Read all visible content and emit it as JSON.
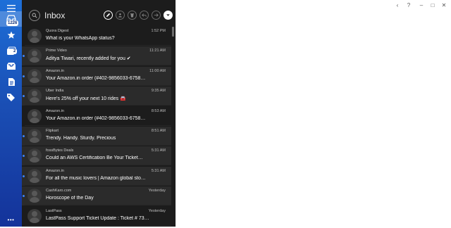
{
  "window": {
    "controls": {
      "back": "‹",
      "help": "?",
      "minimize": "–",
      "maximize": "□",
      "close": "✕"
    }
  },
  "rail": {
    "badge": "1226",
    "badge2": "2",
    "more": "•••"
  },
  "header": {
    "title": "Inbox"
  },
  "messages": [
    {
      "sender": "Quora Digest",
      "time": "1:52 PM",
      "subject": "What is your WhatsApp status?",
      "unread": false
    },
    {
      "sender": "Prime Video",
      "time": "11:21 AM",
      "subject": "Aditya Tiwari, recently added for you ✔",
      "unread": true
    },
    {
      "sender": "Amazon.in",
      "time": "11:00 AM",
      "subject": "Your Amazon.in order (#402-9856033-6758…",
      "unread": true
    },
    {
      "sender": "Uber India",
      "time": "9:35 AM",
      "subject": "Here's 25% off your next 10 rides 🚘",
      "unread": true
    },
    {
      "sender": "Amazon.in",
      "time": "8:53 AM",
      "subject": "Your Amazon.in order (#402-9856033-6758…",
      "unread": false
    },
    {
      "sender": "Flipkart",
      "time": "8:51 AM",
      "subject": "Trendy. Handy. Sturdy. Precious",
      "unread": true
    },
    {
      "sender": "fossBytes Deals",
      "time": "5:31 AM",
      "subject": "Could an AWS Certification Be Your Ticket…",
      "unread": true
    },
    {
      "sender": "Amazon.in",
      "time": "5:31 AM",
      "subject": "For all the music lovers | Amazon global sto…",
      "unread": true
    },
    {
      "sender": "CashKaro.com",
      "time": "Yesterday",
      "subject": "Horoscope of the Day",
      "unread": true
    },
    {
      "sender": "LastPass",
      "time": "Yesterday",
      "subject": "LastPass Support Ticket Update : Ticket # 73…",
      "unread": false
    }
  ],
  "colors": {
    "rail_top": "#1d6fd8",
    "rail_bottom": "#14339a",
    "list_bg": "#1c1c1c",
    "unread_bg": "#2b2b2b",
    "unread_dot": "#3b82f6"
  }
}
